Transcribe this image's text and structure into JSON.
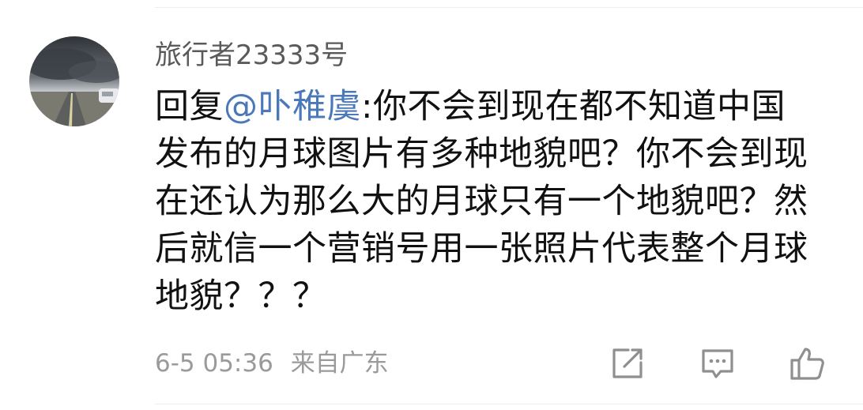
{
  "comment": {
    "username": "旅行者23333号",
    "reply_prefix": "回复",
    "mention": "@卟稚虞",
    "text": ":你不会到现在都不知道中国发布的月球图片有多种地貌吧？你不会到现在还认为那么大的月球只有一个地貌吧？然后就信一个营销号用一张照片代表整个月球地貌？？？",
    "date": "6-5 05:36",
    "location": "来自广东"
  },
  "actions": {
    "share_icon": "share-icon",
    "reply_icon": "comment-icon",
    "like_icon": "thumbs-up-icon"
  },
  "colors": {
    "mention": "#4a78b8",
    "text": "#111111",
    "meta": "#9a9a9a",
    "icon": "#8f8f8f"
  }
}
